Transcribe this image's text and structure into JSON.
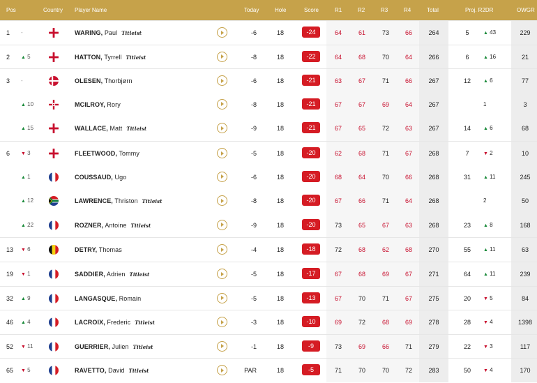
{
  "headers": {
    "pos": "Pos",
    "country": "Country",
    "player": "Player Name",
    "today": "Today",
    "hole": "Hole",
    "score": "Score",
    "r1": "R1",
    "r2": "R2",
    "r3": "R3",
    "r4": "R4",
    "total": "Total",
    "proj": "Proj. R2DR",
    "owgr": "OWGR"
  },
  "colors": {
    "header_bg": "#c6a24a",
    "score_bg": "#d51c24",
    "under_par_red": "#c8102e",
    "up_green": "#1a8a3a"
  },
  "rows": [
    {
      "pos": "1",
      "move": "-",
      "dir": "none",
      "flag": "england",
      "last": "WARING,",
      "first": "Paul",
      "sponsor": "Titleist",
      "today": "-6",
      "hole": "18",
      "score": "-24",
      "r": [
        "64",
        "61",
        "73",
        "66"
      ],
      "total": "264",
      "proj": "5",
      "r2dr": "43",
      "r2dir": "up",
      "owgr": "229"
    },
    {
      "pos": "2",
      "move": "5",
      "dir": "up",
      "flag": "england",
      "last": "HATTON,",
      "first": "Tyrrell",
      "sponsor": "Titleist",
      "today": "-8",
      "hole": "18",
      "score": "-22",
      "r": [
        "64",
        "68",
        "70",
        "64"
      ],
      "total": "266",
      "proj": "6",
      "r2dr": "16",
      "r2dir": "up",
      "owgr": "21"
    },
    {
      "pos": "3",
      "move": "-",
      "dir": "none",
      "flag": "denmark",
      "last": "OLESEN,",
      "first": "Thorbjørn",
      "sponsor": "",
      "today": "-6",
      "hole": "18",
      "score": "-21",
      "r": [
        "63",
        "67",
        "71",
        "66"
      ],
      "total": "267",
      "proj": "12",
      "r2dr": "6",
      "r2dir": "up",
      "owgr": "77"
    },
    {
      "pos": "",
      "move": "10",
      "dir": "up",
      "flag": "ni",
      "last": "MCILROY,",
      "first": "Rory",
      "sponsor": "",
      "today": "-8",
      "hole": "18",
      "score": "-21",
      "r": [
        "67",
        "67",
        "69",
        "64"
      ],
      "total": "267",
      "proj": "",
      "r2dr": "1",
      "r2dir": "none",
      "owgr": "3"
    },
    {
      "pos": "",
      "move": "15",
      "dir": "up",
      "flag": "england",
      "last": "WALLACE,",
      "first": "Matt",
      "sponsor": "Titleist",
      "today": "-9",
      "hole": "18",
      "score": "-21",
      "r": [
        "67",
        "65",
        "72",
        "63"
      ],
      "total": "267",
      "proj": "14",
      "r2dr": "6",
      "r2dir": "up",
      "owgr": "68"
    },
    {
      "pos": "6",
      "move": "3",
      "dir": "down",
      "flag": "england",
      "last": "FLEETWOOD,",
      "first": "Tommy",
      "sponsor": "",
      "today": "-5",
      "hole": "18",
      "score": "-20",
      "r": [
        "62",
        "68",
        "71",
        "67"
      ],
      "total": "268",
      "proj": "7",
      "r2dr": "2",
      "r2dir": "down",
      "owgr": "10"
    },
    {
      "pos": "",
      "move": "1",
      "dir": "up",
      "flag": "france",
      "last": "COUSSAUD,",
      "first": "Ugo",
      "sponsor": "",
      "today": "-6",
      "hole": "18",
      "score": "-20",
      "r": [
        "68",
        "64",
        "70",
        "66"
      ],
      "total": "268",
      "proj": "31",
      "r2dr": "11",
      "r2dir": "up",
      "owgr": "245"
    },
    {
      "pos": "",
      "move": "12",
      "dir": "up",
      "flag": "southafrica",
      "last": "LAWRENCE,",
      "first": "Thriston",
      "sponsor": "Titleist",
      "today": "-8",
      "hole": "18",
      "score": "-20",
      "r": [
        "67",
        "66",
        "71",
        "64"
      ],
      "total": "268",
      "proj": "",
      "r2dr": "2",
      "r2dir": "none",
      "owgr": "50"
    },
    {
      "pos": "",
      "move": "22",
      "dir": "up",
      "flag": "france",
      "last": "ROZNER,",
      "first": "Antoine",
      "sponsor": "Titleist",
      "today": "-9",
      "hole": "18",
      "score": "-20",
      "r": [
        "73",
        "65",
        "67",
        "63"
      ],
      "total": "268",
      "proj": "23",
      "r2dr": "8",
      "r2dir": "up",
      "owgr": "168"
    },
    {
      "pos": "13",
      "move": "6",
      "dir": "down",
      "flag": "belgium",
      "last": "DETRY,",
      "first": "Thomas",
      "sponsor": "",
      "today": "-4",
      "hole": "18",
      "score": "-18",
      "r": [
        "72",
        "68",
        "62",
        "68"
      ],
      "total": "270",
      "proj": "55",
      "r2dr": "11",
      "r2dir": "up",
      "owgr": "63"
    },
    {
      "pos": "19",
      "move": "1",
      "dir": "down",
      "flag": "france",
      "last": "SADDIER,",
      "first": "Adrien",
      "sponsor": "Titleist",
      "today": "-5",
      "hole": "18",
      "score": "-17",
      "r": [
        "67",
        "68",
        "69",
        "67"
      ],
      "total": "271",
      "proj": "64",
      "r2dr": "11",
      "r2dir": "up",
      "owgr": "239"
    },
    {
      "pos": "32",
      "move": "9",
      "dir": "up",
      "flag": "france",
      "last": "LANGASQUE,",
      "first": "Romain",
      "sponsor": "",
      "today": "-5",
      "hole": "18",
      "score": "-13",
      "r": [
        "67",
        "70",
        "71",
        "67"
      ],
      "total": "275",
      "proj": "20",
      "r2dr": "5",
      "r2dir": "down",
      "owgr": "84"
    },
    {
      "pos": "46",
      "move": "4",
      "dir": "up",
      "flag": "france",
      "last": "LACROIX,",
      "first": "Frederic",
      "sponsor": "Titleist",
      "today": "-3",
      "hole": "18",
      "score": "-10",
      "r": [
        "69",
        "72",
        "68",
        "69"
      ],
      "total": "278",
      "proj": "28",
      "r2dr": "4",
      "r2dir": "down",
      "owgr": "1398"
    },
    {
      "pos": "52",
      "move": "11",
      "dir": "down",
      "flag": "france",
      "last": "GUERRIER,",
      "first": "Julien",
      "sponsor": "Titleist",
      "today": "-1",
      "hole": "18",
      "score": "-9",
      "r": [
        "73",
        "69",
        "66",
        "71"
      ],
      "total": "279",
      "proj": "22",
      "r2dr": "3",
      "r2dir": "down",
      "owgr": "117"
    },
    {
      "pos": "65",
      "move": "5",
      "dir": "down",
      "flag": "france",
      "last": "RAVETTO,",
      "first": "David",
      "sponsor": "Titleist",
      "today": "PAR",
      "hole": "18",
      "score": "-5",
      "r": [
        "71",
        "70",
        "70",
        "72"
      ],
      "total": "283",
      "proj": "50",
      "r2dr": "4",
      "r2dir": "down",
      "owgr": "170"
    }
  ]
}
